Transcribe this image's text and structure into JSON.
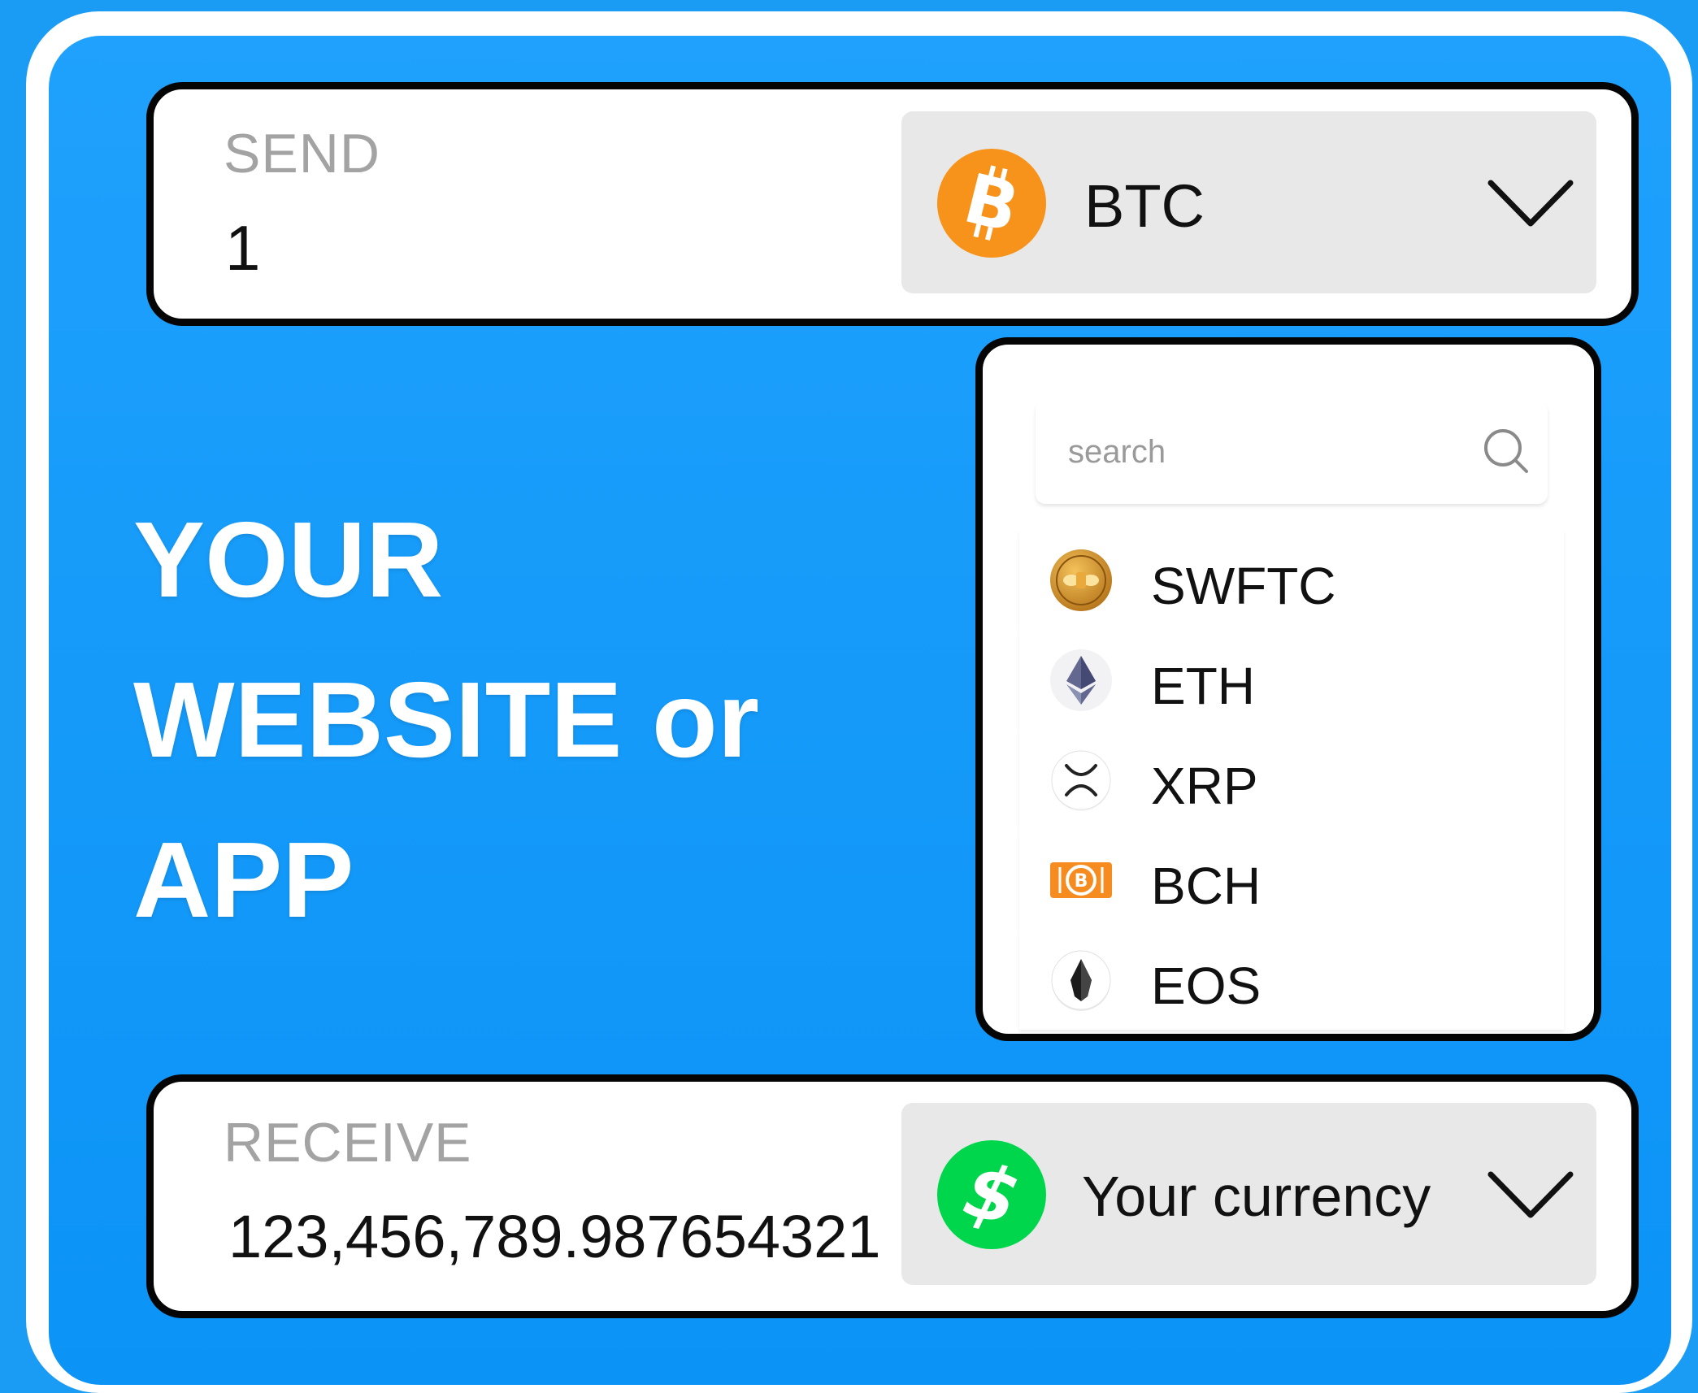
{
  "send": {
    "label": "SEND",
    "amount": "1",
    "selected_currency": "BTC",
    "currency_icon": "bitcoin-icon",
    "chevron_icon": "chevron-down-icon"
  },
  "headline": {
    "line1": "YOUR",
    "line2": "WEBSITE or",
    "line3": "APP"
  },
  "dropdown": {
    "search_placeholder": "search",
    "search_icon": "search-icon",
    "items": [
      {
        "symbol": "SWFTC",
        "icon": "swftc-coin-icon"
      },
      {
        "symbol": "ETH",
        "icon": "ethereum-icon"
      },
      {
        "symbol": "XRP",
        "icon": "xrp-icon"
      },
      {
        "symbol": "BCH",
        "icon": "bitcoin-cash-icon"
      },
      {
        "symbol": "EOS",
        "icon": "eos-icon"
      }
    ]
  },
  "receive": {
    "label": "RECEIVE",
    "amount": "123,456,789.987654321",
    "selected_currency": "Your currency",
    "currency_icon": "dollar-icon",
    "chevron_icon": "chevron-down-icon"
  },
  "colors": {
    "background_blue": "#1a9cf5",
    "bitcoin_orange": "#f7931a",
    "cash_green": "#00d64b",
    "bch_orange": "#f68b1f"
  }
}
